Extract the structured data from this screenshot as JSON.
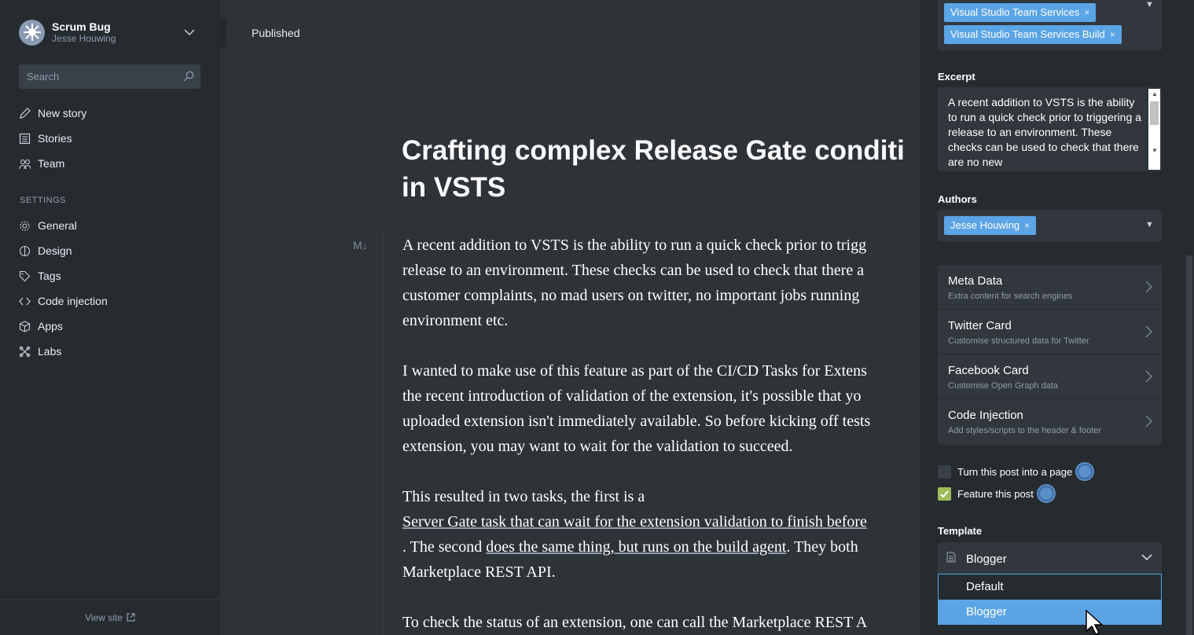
{
  "sidebar": {
    "blog_name": "Scrum Bug",
    "user_name": "Jesse Houwing",
    "search_placeholder": "Search",
    "nav": [
      {
        "label": "New story",
        "icon": "pencil-icon"
      },
      {
        "label": "Stories",
        "icon": "list-icon"
      },
      {
        "label": "Team",
        "icon": "team-icon"
      }
    ],
    "settings_label": "SETTINGS",
    "settings_nav": [
      {
        "label": "General",
        "icon": "gear-icon"
      },
      {
        "label": "Design",
        "icon": "design-icon"
      },
      {
        "label": "Tags",
        "icon": "tag-icon"
      },
      {
        "label": "Code injection",
        "icon": "code-icon"
      },
      {
        "label": "Apps",
        "icon": "apps-icon"
      },
      {
        "label": "Labs",
        "icon": "labs-icon"
      }
    ],
    "view_site": "View site"
  },
  "editor": {
    "status": "Published",
    "md_icon": "M↓",
    "title_line1": "Crafting complex Release Gate conditi",
    "title_line2": "in VSTS",
    "p1": [
      "A recent addition to VSTS is the ability to run a quick check prior to trigg",
      "release to an environment. These checks can be used to check that there a",
      "customer complaints, no mad users on twitter, no important jobs running",
      "environment etc."
    ],
    "p2": [
      "I wanted to make use of this feature as part of the CI/CD Tasks for Extens",
      "the recent introduction of validation of the extension, it's possible that yo",
      "uploaded extension isn't immediately available. So before kicking off tests",
      "extension, you may want to wait for the validation to succeed."
    ],
    "p3_line1": "This resulted in two tasks, the first is a",
    "p3_link1": "Server Gate task that can wait for the extension validation to finish before",
    "p3_line3_pre": ". The second ",
    "p3_link2": "does the same thing, but runs on the build agent",
    "p3_line3_post": ". They both",
    "p3_line4": "Marketplace REST API.",
    "p4": "To check the status of an extension, one can call the Marketplace REST A"
  },
  "panel": {
    "tags": [
      "Visual Studio Team Services",
      "Visual Studio Team Services Build"
    ],
    "tag_remove": "×",
    "excerpt_label": "Excerpt",
    "excerpt": "A recent addition to VSTS is the ability to run a quick check prior to triggering a release to an environment. These checks can be used to check that there are no new",
    "authors_label": "Authors",
    "authors": [
      "Jesse Houwing"
    ],
    "menu": [
      {
        "title": "Meta Data",
        "sub": "Extra content for search engines"
      },
      {
        "title": "Twitter Card",
        "sub": "Customise structured data for Twitter"
      },
      {
        "title": "Facebook Card",
        "sub": "Customise Open Graph data"
      },
      {
        "title": "Code Injection",
        "sub": "Add styles/scripts to the header & footer"
      }
    ],
    "page_toggle": {
      "label": "Turn this post into a page",
      "checked": false
    },
    "feature_toggle": {
      "label": "Feature this post",
      "checked": true
    },
    "template_label": "Template",
    "template_value": "Blogger",
    "template_options": [
      "Default",
      "Blogger"
    ],
    "selected_option": "Blogger",
    "accent": "#5ba4e5",
    "check_color": "#9fbb58"
  }
}
